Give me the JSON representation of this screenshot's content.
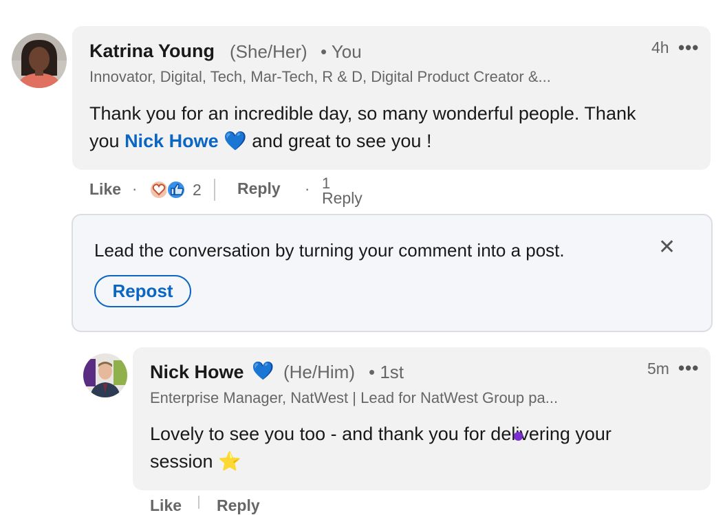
{
  "comment": {
    "author": "Katrina Young",
    "pronouns": "(She/Her)",
    "relation": "• You",
    "headline": "Innovator, Digital, Tech, Mar-Tech, R & D, Digital Product Creator &...",
    "time": "4h",
    "more": "•••",
    "text_part1": "Thank you for an incredible day, so many wonderful people. Thank",
    "text_part2_pre": "you",
    "mention": "Nick Howe",
    "emoji": "💙",
    "text_part2_post": "and great to see you !",
    "actions": {
      "like": "Like",
      "dot": "·",
      "reaction_count": "2",
      "reply": "Reply",
      "replies_count": "1",
      "replies_label": "Reply"
    }
  },
  "repost_prompt": {
    "text": "Lead the conversation by turning your comment into a post.",
    "button": "Repost",
    "close": "✕"
  },
  "reply": {
    "author": "Nick Howe",
    "author_emoji": "💙",
    "pronouns": "(He/Him)",
    "relation": "• 1st",
    "headline": "Enterprise Manager, NatWest | Lead for NatWest Group pa...",
    "time": "5m",
    "more": "•••",
    "text_line1": "Lovely to see you too - and thank you for delivering your",
    "text_line2": "session",
    "emoji": "⭐",
    "actions": {
      "like": "Like",
      "reply": "Reply"
    }
  },
  "colors": {
    "accent": "#0a66c2",
    "bubble": "#f2f2f2",
    "card": "#f4f6f9"
  }
}
